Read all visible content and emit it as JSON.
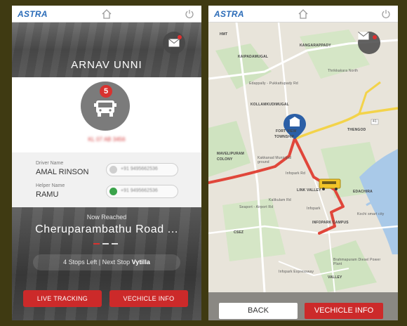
{
  "app": {
    "logo_text": "ASTRA"
  },
  "colors": {
    "brand_blue": "#2b6cb8",
    "accent_red": "#cc2a2a",
    "badge_red": "#d8322f",
    "call_green": "#3aa34a",
    "route_red": "#e0463a"
  },
  "icons": {
    "home": "home-icon",
    "power": "power-icon",
    "mail": "mail-icon",
    "bus": "bus-icon",
    "phone": "phone-icon",
    "school_marker": "school-marker-icon",
    "bus_marker": "bus-marker-icon"
  },
  "left_screen": {
    "driver_header": "ARNAV UNNI",
    "bus_badge": "5",
    "vehicle_number": "KL 07 AB 3456",
    "driver": {
      "label": "Driver Name",
      "name": "AMAL RINSON",
      "phone": "+91 9495662536"
    },
    "helper": {
      "label": "Helper Name",
      "name": "RAMU",
      "phone": "+91 9495662536"
    },
    "status": {
      "now_reached_label": "Now Reached",
      "stop_name": "Cheruparambathu Road ...",
      "stops_left_text": "4 Stops Left",
      "separator": "|",
      "next_stop_label": "Next Stop",
      "next_stop_name": "Vytilla"
    },
    "buttons": {
      "live_tracking": "LIVE TRACKING",
      "vehicle_info": "VECHICLE INFO"
    }
  },
  "right_screen": {
    "map_labels": {
      "hmt": "HMT",
      "kaipadamugal": "KAIPADAMUGAL",
      "kangarappady": "KANGARAPPADY",
      "thrikkakara_north": "Thrikkakara North",
      "edappally": "Edappally - Pukkattupady Rd",
      "kollamkudimugal": "KOLLAMKUDIMUGAL",
      "fort_view": "FORT VIEW",
      "township": "TOWNSHIP",
      "thengod": "THENGOD",
      "mavelipuram": "MAVELIPURAM",
      "colony": "COLONY",
      "kakkanad": "Kakkanad Municipal ground",
      "link_valley": "LINK VALLEY",
      "edachira": "EDACHIRA",
      "infopark": "Infopark",
      "infopark_campus": "INFOPARK CAMPUS",
      "kochi_smart_city": "Kochi smart city",
      "csez": "CSEZ",
      "brahmapuram": "Brahmapuram Diesel Power Plant",
      "infopark_expressway": "Infopark Expressway",
      "seaport_airport": "Seaport - Airport Rd",
      "kalikulam": "Kalikulam Rd",
      "infopark_rd": "Infopark Rd",
      "valley": "VALLEY",
      "road_41": "41"
    },
    "buttons": {
      "back": "BACK",
      "vehicle_info": "VECHICLE INFO"
    }
  }
}
